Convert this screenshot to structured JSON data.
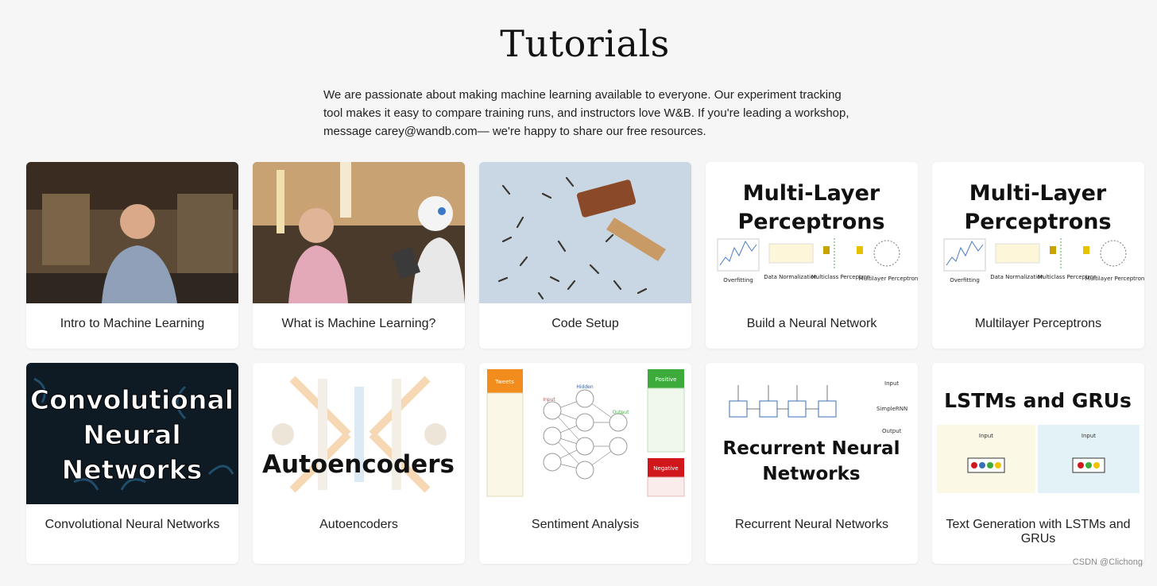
{
  "page": {
    "title": "Tutorials",
    "intro": "We are passionate about making machine learning available to everyone. Our experiment tracking tool makes it easy to compare training runs, and instructors love W&B. If you're leading a workshop, message carey@wandb.com— we're happy to share our free resources."
  },
  "cards": [
    {
      "label": "Intro to Machine Learning",
      "thumb": "photo-man-in-lab"
    },
    {
      "label": "What is Machine Learning?",
      "thumb": "photo-girl-and-robot"
    },
    {
      "label": "Code Setup",
      "thumb": "photo-hammer-and-nails"
    },
    {
      "label": "Build a Neural Network",
      "thumb_title_1": "Multi-Layer",
      "thumb_title_2": "Perceptrons",
      "thumb_captions": [
        "Overfitting",
        "Data Normalization",
        "Multiclass Perceptron",
        "Multilayer Perceptron"
      ]
    },
    {
      "label": "Multilayer Perceptrons",
      "thumb_title_1": "Multi-Layer",
      "thumb_title_2": "Perceptrons",
      "thumb_captions": [
        "Overfitting",
        "Data Normalization",
        "Multiclass Perceptron",
        "Multilayer Perceptron"
      ]
    },
    {
      "label": "Convolutional Neural Networks",
      "thumb_title_1": "Convolutional",
      "thumb_title_2": "Neural",
      "thumb_title_3": "Networks"
    },
    {
      "label": "Autoencoders",
      "thumb_title_1": "Autoencoders"
    },
    {
      "label": "Sentiment Analysis",
      "thumb_labels": {
        "tweets": "Tweets",
        "input": "Input",
        "hidden": "Hidden",
        "output": "Output",
        "positive": "Positive",
        "negative": "Negative"
      }
    },
    {
      "label": "Recurrent Neural Networks",
      "thumb_title_1": "Recurrent Neural",
      "thumb_title_2": "Networks",
      "thumb_labels": {
        "input": "Input",
        "simplernn": "SimpleRNN",
        "output": "Output"
      }
    },
    {
      "label": "Text Generation with LSTMs and GRUs",
      "thumb_title_1": "LSTMs and GRUs",
      "thumb_labels": {
        "input": "Input"
      }
    }
  ],
  "watermark": "CSDN @Clichong",
  "colors": {
    "background": "#f6f6f6",
    "card": "#ffffff",
    "text": "#222222"
  }
}
